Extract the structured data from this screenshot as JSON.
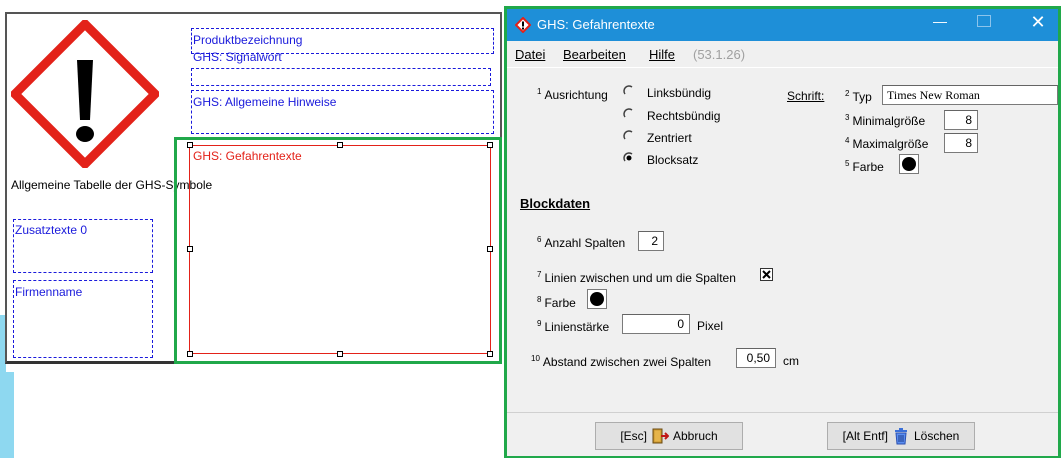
{
  "canvas": {
    "product_label": "Produktbezeichnung",
    "signalword_label": "GHS: Signalwort",
    "hints_label": "GHS: Allgemeine Hinweise",
    "hazard_texts_label": "GHS: Gefahrentexte",
    "symbol_table_label": "Allgemeine Tabelle der GHS-Symbole",
    "extra_texts_label": "Zusatztexte 0",
    "company_label": "Firmenname"
  },
  "dialog": {
    "title": "GHS: Gefahrentexte",
    "menu": {
      "datei": "Datei",
      "bearbeiten": "Bearbeiten",
      "hilfe": "Hilfe",
      "version": "(53.1.26)"
    },
    "alignment": {
      "num": "1",
      "label": "Ausrichtung",
      "options": [
        "Linksbündig",
        "Rechtsbündig",
        "Zentriert",
        "Blocksatz"
      ],
      "selected": "Blocksatz"
    },
    "font": {
      "section_label": "Schrift:",
      "type_num": "2",
      "type_label": "Typ",
      "type_value": "Times New Roman",
      "min_num": "3",
      "min_label": "Minimalgröße",
      "min_value": "8",
      "max_num": "4",
      "max_label": "Maximalgröße",
      "max_value": "8",
      "color_num": "5",
      "color_label": "Farbe"
    },
    "block": {
      "heading": "Blockdaten",
      "columns_num": "6",
      "columns_label": "Anzahl Spalten",
      "columns_value": "2",
      "lines_num": "7",
      "lines_label": "Linien zwischen und um die Spalten",
      "lines_checked": true,
      "color_num": "8",
      "color_label": "Farbe",
      "width_num": "9",
      "width_label": "Linienstärke",
      "width_value": "0",
      "width_unit": "Pixel",
      "gap_num": "10",
      "gap_label": "Abstand zwischen zwei Spalten",
      "gap_value": "0,50",
      "gap_unit": "cm"
    },
    "buttons": {
      "cancel": "[Esc]",
      "cancel_text": "Abbruch",
      "delete": "[Alt Entf]",
      "delete_text": "Löschen"
    }
  },
  "colors": {
    "titlebar": "#1e8fd8",
    "selection_frame": "#20a84a",
    "hazard_red": "#e32219",
    "label_blue": "#1a1adb"
  }
}
